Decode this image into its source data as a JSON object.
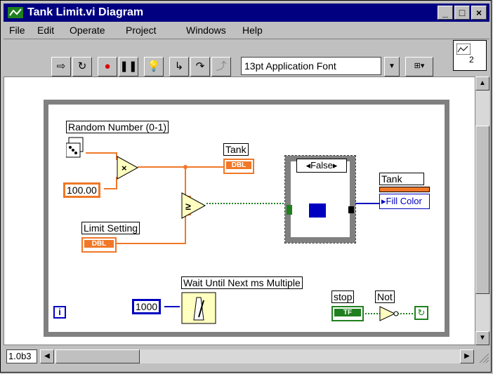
{
  "window": {
    "title": "Tank Limit.vi Diagram"
  },
  "title_buttons": {
    "minimize": "_",
    "maximize": "□",
    "close": "×"
  },
  "menu": [
    "File",
    "Edit",
    "Operate",
    "Project",
    "Windows",
    "Help"
  ],
  "toolbar": {
    "font_select": "13pt Application Font",
    "icon_number": "2"
  },
  "diagram": {
    "labels": {
      "random": "Random Number (0-1)",
      "tank_indicator": "Tank",
      "multiply_constant": "100.00",
      "limit": "Limit Setting",
      "wait": "Wait Until Next ms Multiple",
      "wait_constant": "1000",
      "stop": "stop",
      "not": "Not",
      "case": "False",
      "tank_prop": "Tank",
      "fill_color": "Fill Color",
      "dbl": "DBL",
      "tf": "TF",
      "loop_index": "i"
    }
  },
  "status": {
    "version": "1.0b3"
  }
}
